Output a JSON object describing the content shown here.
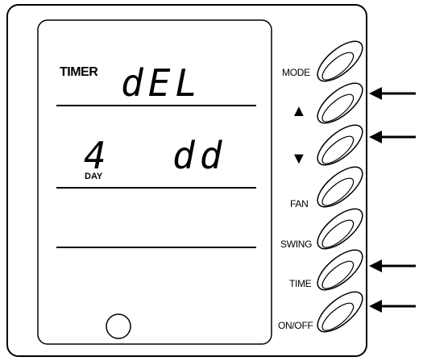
{
  "lcd": {
    "timer_label": "TIMER",
    "mode_value": "dEL",
    "day_number": "4",
    "day_label": "DAY",
    "day_value": "dd"
  },
  "buttons": {
    "mode": "MODE",
    "up": "▲",
    "down": "▼",
    "fan": "FAN",
    "swing": "SWING",
    "time": "TIME",
    "onoff": "ON/OFF"
  },
  "icons": {
    "pointer_arrows": [
      "arrow-left-icon"
    ]
  }
}
